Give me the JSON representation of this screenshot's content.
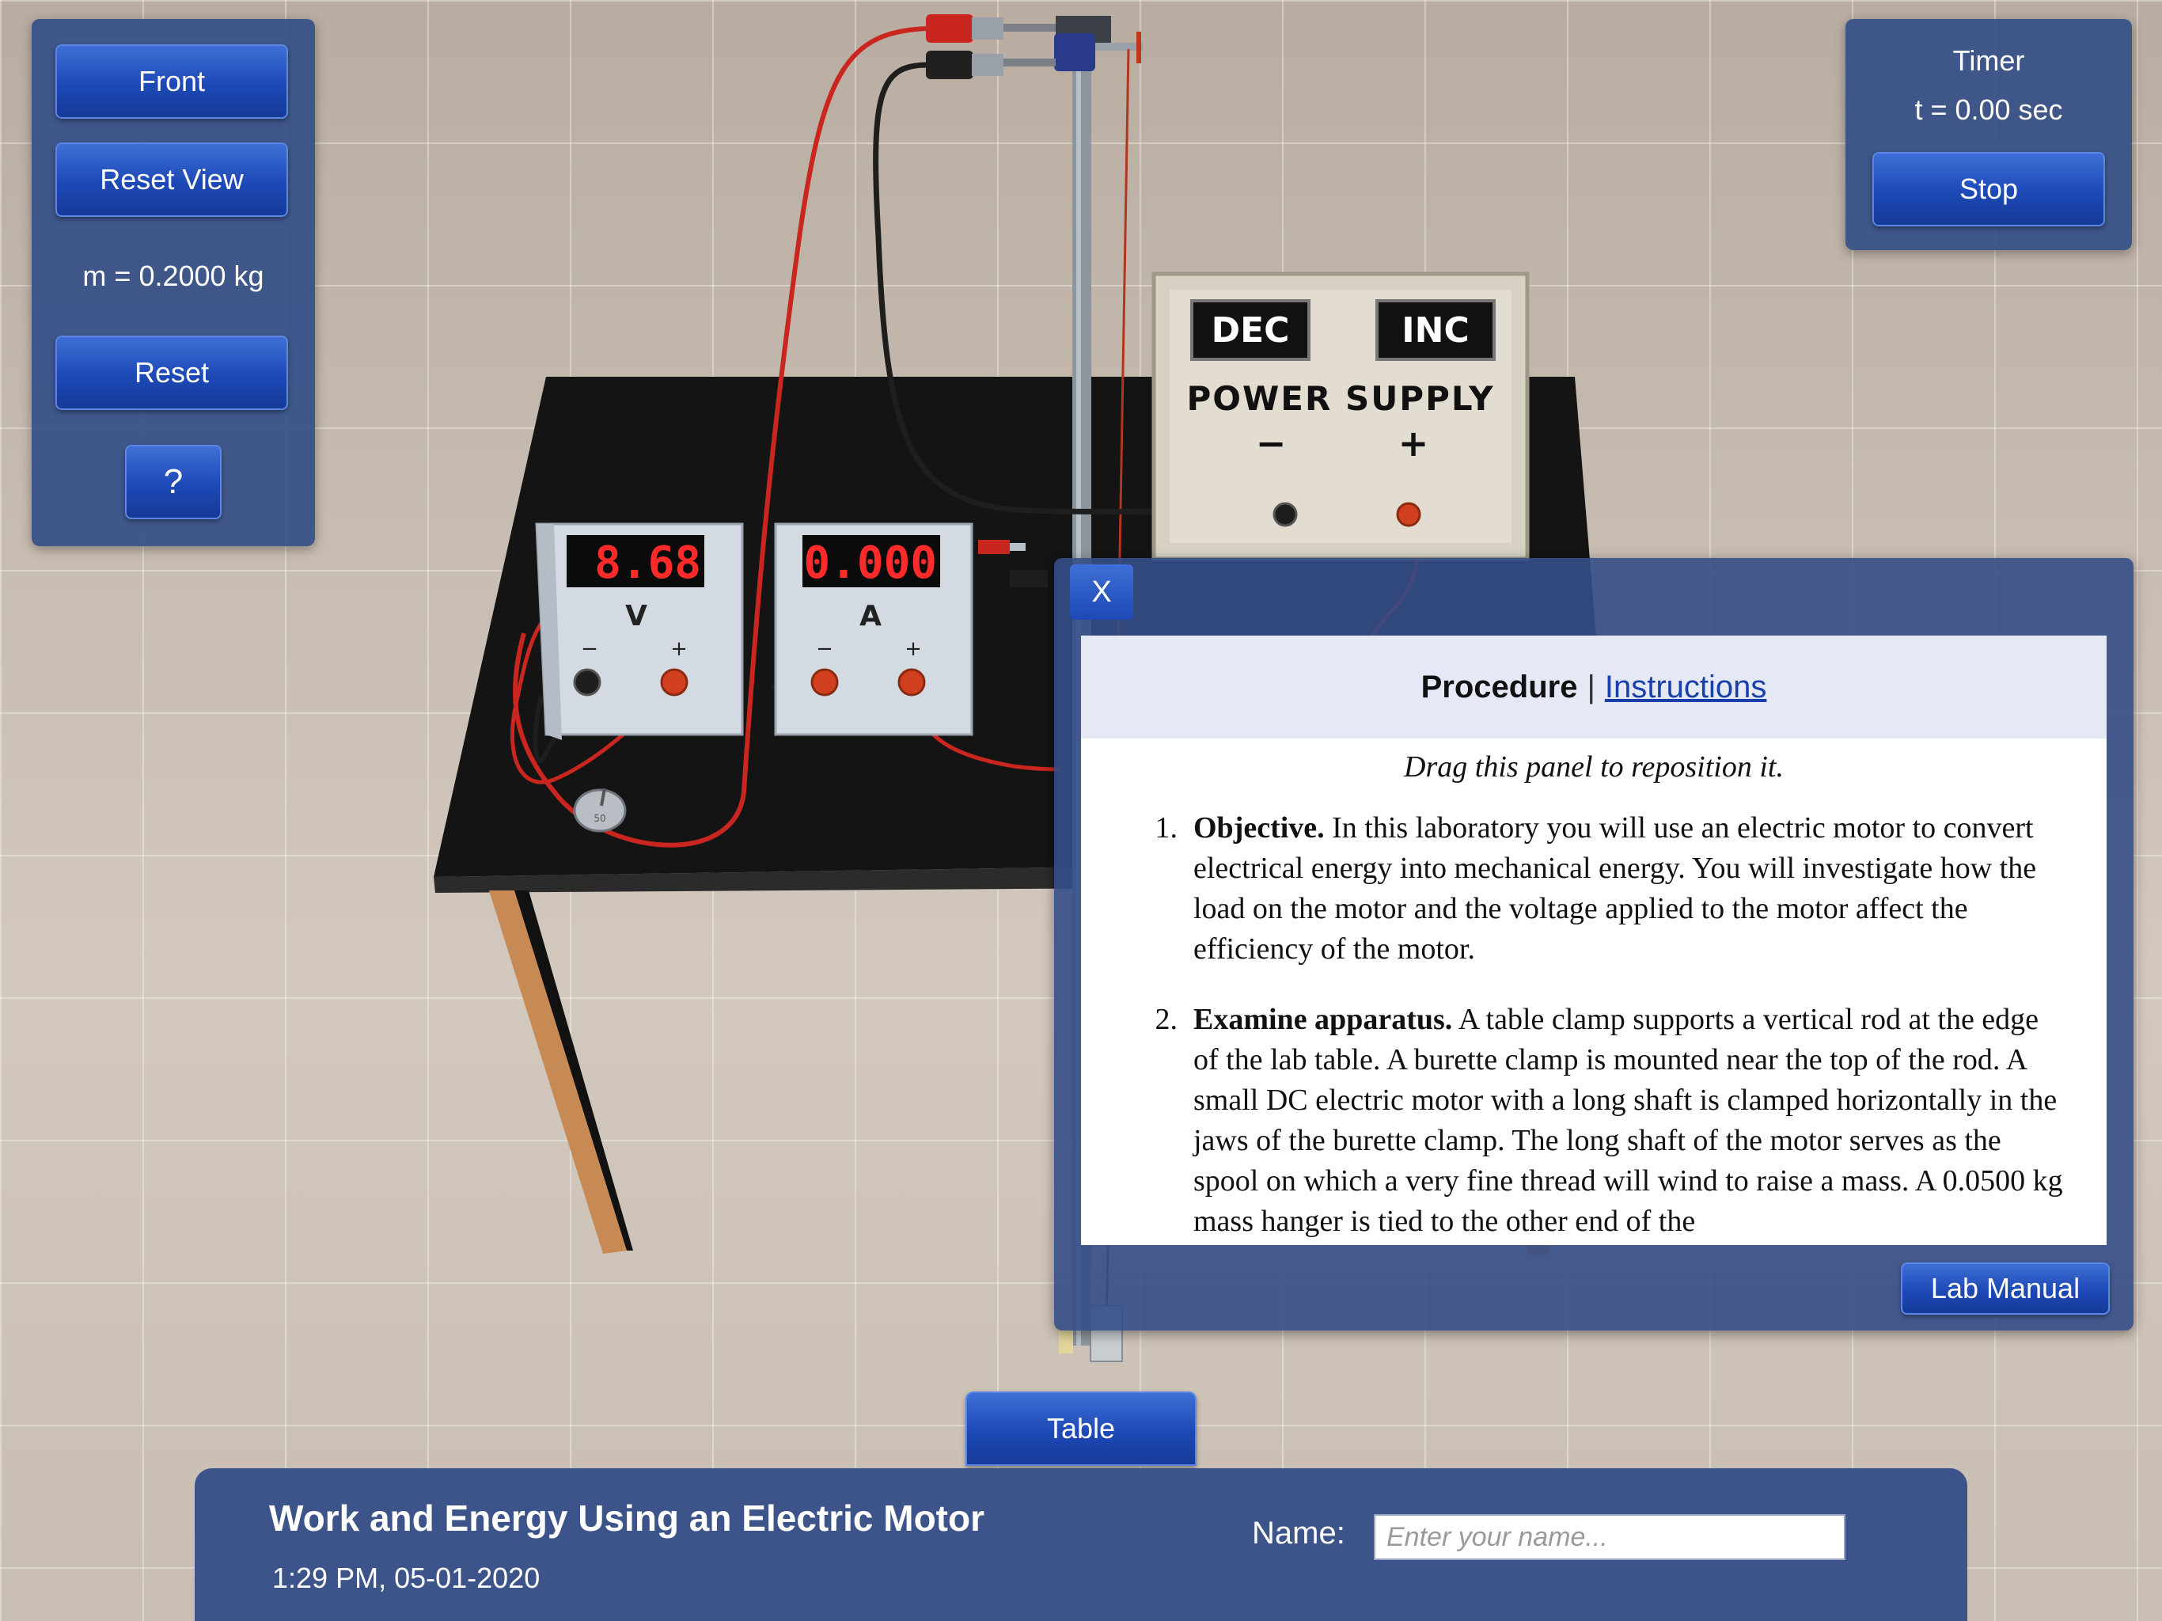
{
  "left_panel": {
    "front_label": "Front",
    "reset_view_label": "Reset View",
    "mass_text": "m = 0.2000 kg",
    "reset_label": "Reset",
    "help_label": "?"
  },
  "timer_panel": {
    "title": "Timer",
    "time_text": "t = 0.00 sec",
    "stop_label": "Stop"
  },
  "power_supply": {
    "dec_label": "DEC",
    "inc_label": "INC",
    "title": "POWER SUPPLY",
    "minus_label": "−",
    "plus_label": "+"
  },
  "voltmeter": {
    "reading": "8.68",
    "unit": "V",
    "minus": "−",
    "plus": "+"
  },
  "ammeter": {
    "reading": "0.000",
    "unit": "A",
    "minus": "−",
    "plus": "+"
  },
  "mass_weight_label": "50",
  "procedure": {
    "close_label": "X",
    "tab_active": "Procedure",
    "separator": "|",
    "tab_link": "Instructions",
    "note": "Drag this panel to reposition it.",
    "items": [
      {
        "num": "1.",
        "heading": "Objective.",
        "text": "In this laboratory you will use an electric motor to convert electrical energy into mechanical energy. You will investigate how the load on the motor and the voltage applied to the motor affect the efficiency of the motor."
      },
      {
        "num": "2.",
        "heading": "Examine apparatus.",
        "text": "A table clamp supports a vertical rod at the edge of the lab table. A burette clamp is mounted near the top of the rod. A small DC electric motor with a long shaft is clamped horizontally in the jaws of the burette clamp. The long shaft of the motor serves as the spool on which a very fine thread will wind to raise a mass. A 0.0500 kg mass hanger is tied to the other end of the"
      }
    ],
    "lab_manual_label": "Lab Manual"
  },
  "table_button_label": "Table",
  "bottom_bar": {
    "title": "Work and Energy Using an Electric Motor",
    "datetime": "1:29 PM, 05-01-2020",
    "name_label": "Name:",
    "name_placeholder": "Enter your name...",
    "name_value": ""
  },
  "colors": {
    "panel_bg": "#344e87",
    "button_blue": "#1d49b6",
    "meter_digits": "#ff2a2a",
    "lab_table_top": "#111111"
  }
}
